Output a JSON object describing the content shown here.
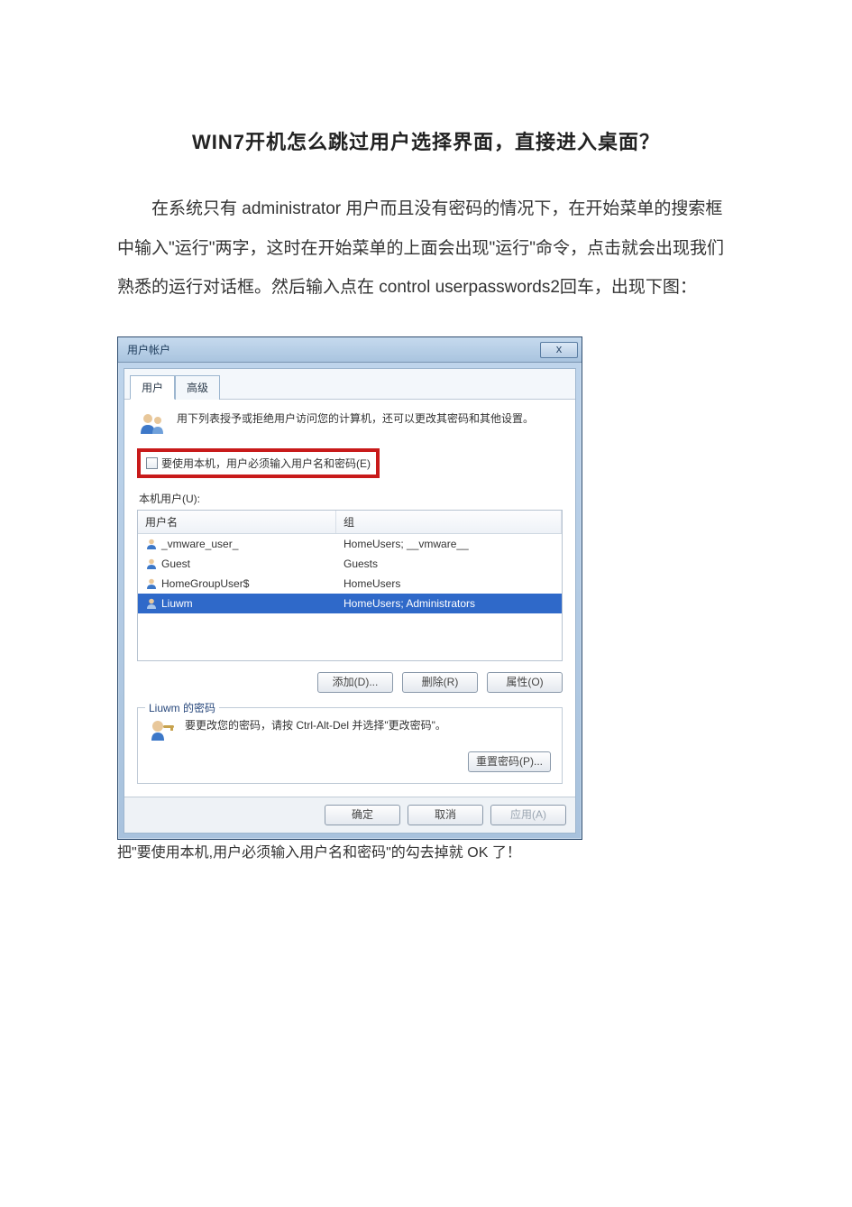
{
  "article": {
    "title": "WIN7开机怎么跳过用户选择界面，直接进入桌面？",
    "para1": "在系统只有 administrator 用户而且没有密码的情况下，在开始菜单的搜索框中输入\"运行\"两字，这时在开始菜单的上面会出现\"运行\"命令，点击就会出现我们熟悉的运行对话框。然后输入点在 control userpasswords2回车，出现下图：",
    "after": "把\"要使用本机,用户必须输入用户名和密码\"的勾去掉就 OK 了！"
  },
  "dialog": {
    "title": "用户帐户",
    "close_glyph": "x",
    "tabs": {
      "users": "用户",
      "advanced": "高级"
    },
    "intro": "用下列表授予或拒绝用户访问您的计算机，还可以更改其密码和其他设置。",
    "checkbox_label": "要使用本机，用户必须输入用户名和密码(E)",
    "list_label": "本机用户(U):",
    "columns": {
      "user": "用户名",
      "group": "组"
    },
    "rows": [
      {
        "user": "_vmware_user_",
        "group": "HomeUsers; __vmware__",
        "selected": false
      },
      {
        "user": "Guest",
        "group": "Guests",
        "selected": false
      },
      {
        "user": "HomeGroupUser$",
        "group": "HomeUsers",
        "selected": false
      },
      {
        "user": "Liuwm",
        "group": "HomeUsers; Administrators",
        "selected": true
      }
    ],
    "buttons": {
      "add": "添加(D)...",
      "remove": "删除(R)",
      "props": "属性(O)"
    },
    "groupbox_title": "Liuwm 的密码",
    "pw_text": "要更改您的密码，请按 Ctrl-Alt-Del 并选择\"更改密码\"。",
    "reset_pw": "重置密码(P)...",
    "bottom": {
      "ok": "确定",
      "cancel": "取消",
      "apply": "应用(A)"
    }
  }
}
